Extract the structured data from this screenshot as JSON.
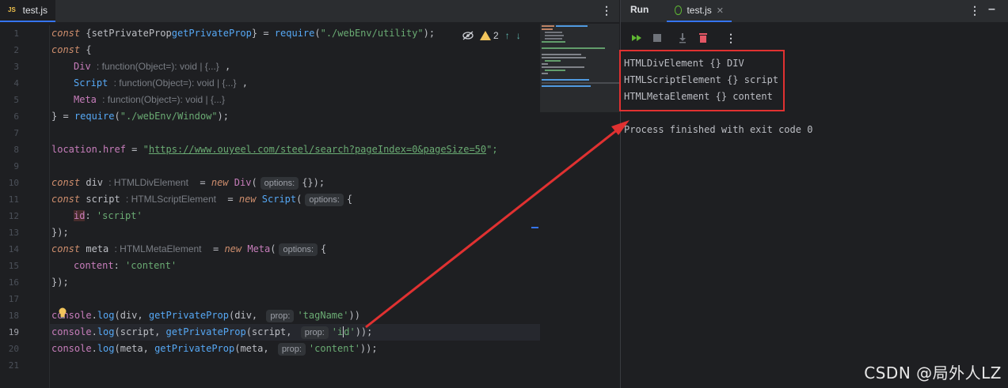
{
  "editor": {
    "tab_label": "test.js",
    "tab_icon": "js-file-icon",
    "line_numbers": [
      "1",
      "2",
      "3",
      "4",
      "5",
      "6",
      "7",
      "8",
      "9",
      "10",
      "11",
      "12",
      "13",
      "14",
      "15",
      "16",
      "17",
      "18",
      "19",
      "20",
      "21"
    ],
    "current_line": "19",
    "inspection": {
      "warning_count": "2"
    },
    "code": {
      "l1": {
        "kw": "const",
        "open": " {",
        "a": "setPrivateProp",
        ", ": ", ",
        "b": "getPrivateProp",
        "close": "} = ",
        "req": "require",
        "p1": "(",
        "s": "\"./webEnv/utility\"",
        "p2": ");"
      },
      "l2": {
        "kw": "const",
        "rest": " {"
      },
      "l3": {
        "name": "Div",
        "hint": ": function(Object=): void | {...}",
        "tail": " ,"
      },
      "l4": {
        "name": "Script",
        "hint": ": function(Object=): void | {...}",
        "tail": " ,"
      },
      "l5": {
        "name": "Meta",
        "hint": ": function(Object=): void | {...}"
      },
      "l6": {
        "a": "} = ",
        "req": "require",
        "p1": "(",
        "s": "\"./webEnv/Window\"",
        "p2": ");"
      },
      "l8": {
        "obj": "location",
        "dot": ".",
        "prop": "href",
        "eq": " = ",
        "q1": "\"",
        "url": "https://www.ouyeel.com/steel/search?pageIndex=0&pageSize=50",
        "q2": "\";"
      },
      "l10": {
        "kw": "const",
        "name": " div ",
        "type": ": HTMLDivElement",
        "eq": "  = ",
        "nw": "new",
        "cls": " Div",
        "p": "(",
        "hint": "options:",
        "rest": "{});"
      },
      "l11": {
        "kw": "const",
        "name": " script ",
        "type": ": HTMLScriptElement",
        "eq": "  = ",
        "nw": "new",
        "cls": " Script",
        "p": "(",
        "hint": "options:",
        "rest": "{"
      },
      "l12": {
        "key": "id",
        "colon": ": ",
        "val": "'script'"
      },
      "l13": {
        "text": "});"
      },
      "l14": {
        "kw": "const",
        "name": " meta ",
        "type": ": HTMLMetaElement",
        "eq": "  = ",
        "nw": "new",
        "cls": " Meta",
        "p": "(",
        "hint": "options:",
        "rest": "{"
      },
      "l15": {
        "key": "content",
        "colon": ": ",
        "val": "'content'"
      },
      "l16": {
        "text": "});"
      },
      "l18": {
        "obj": "console",
        "dot": ".",
        "fn": "log",
        "a": "(div, ",
        "g": "getPrivateProp",
        "b": "(div, ",
        "hint": "prop:",
        "s": "'tagName'",
        "c": "))"
      },
      "l19": {
        "obj": "console",
        "dot": ".",
        "fn": "log",
        "a": "(script, ",
        "g": "getPrivateProp",
        "b": "(script, ",
        "hint": "prop:",
        "s1": "'i",
        "s2": "d'",
        "c": "));"
      },
      "l20": {
        "obj": "console",
        "dot": ".",
        "fn": "log",
        "a": "(meta, ",
        "g": "getPrivateProp",
        "b": "(meta, ",
        "hint": "prop:",
        "s": "'content'",
        "c": "));"
      }
    }
  },
  "run": {
    "title": "Run",
    "tab_label": "test.js",
    "tab_icon": "nodejs-icon",
    "toolbar": [
      "rerun-icon",
      "stop-icon",
      "scroll-to-end-icon",
      "clear-icon",
      "more-icon"
    ],
    "output": [
      "HTMLDivElement {} DIV",
      "HTMLScriptElement {} script",
      "HTMLMetaElement {} content",
      "",
      "Process finished with exit code 0"
    ]
  },
  "annotation": {
    "color": "#e03131"
  },
  "watermark": "CSDN @局外人LZ",
  "colors": {
    "accent": "#3574f0",
    "keyword": "#cf8e6d",
    "function": "#56a8f5",
    "string": "#6aab73",
    "property": "#c77dbb"
  }
}
